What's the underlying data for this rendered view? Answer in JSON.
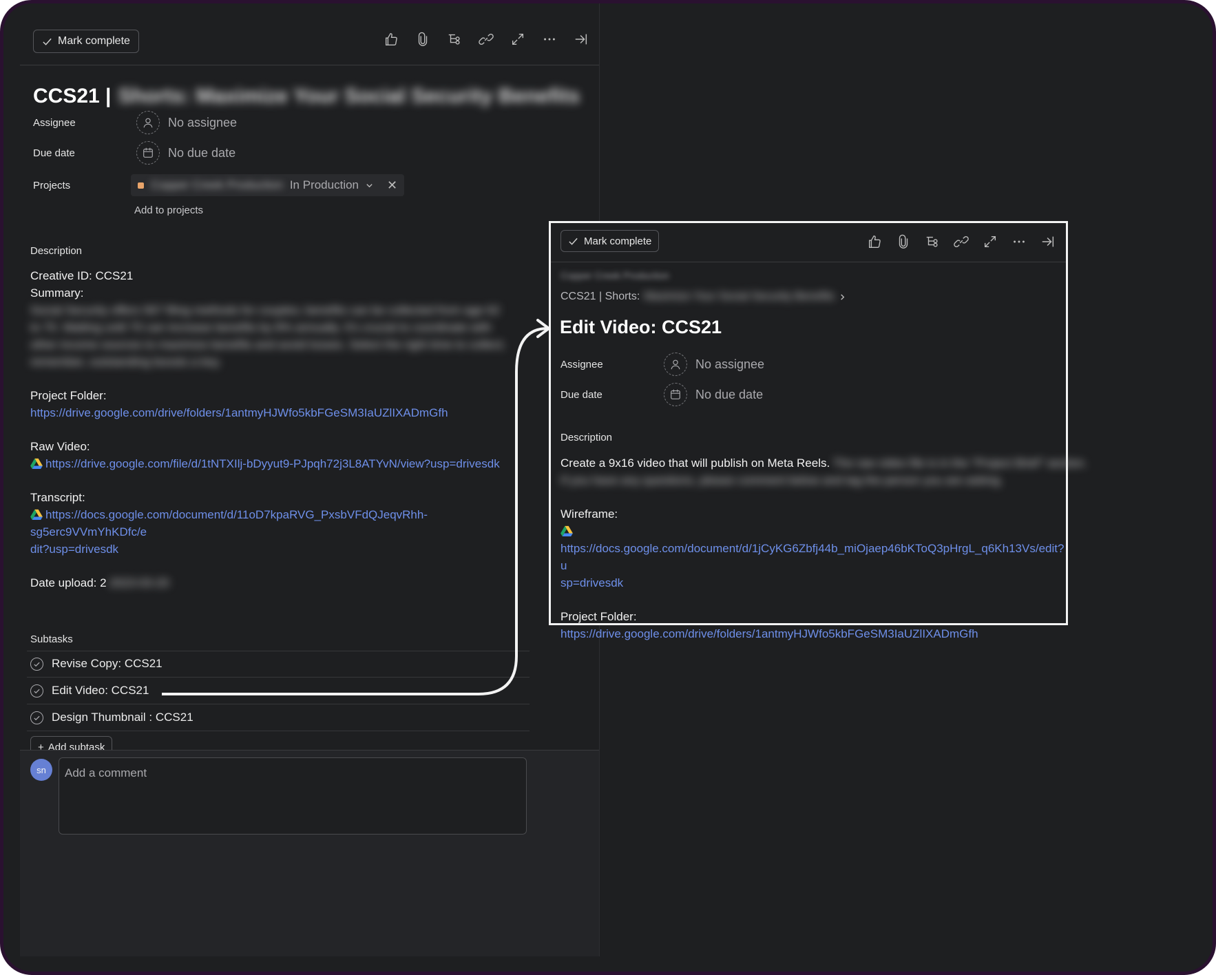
{
  "left": {
    "toolbar": {
      "mark_complete": "Mark complete"
    },
    "title_prefix": "CCS21 |",
    "title_redacted": "Shorts: Maximize Your Social Security Benefits",
    "assignee": {
      "label": "Assignee",
      "value": "No assignee"
    },
    "due_date": {
      "label": "Due date",
      "value": "No due date"
    },
    "projects": {
      "label": "Projects",
      "project_name_redacted": "Copper Creek Production",
      "section": "In Production",
      "add": "Add to projects"
    },
    "description": {
      "label": "Description",
      "creative_id": "Creative ID: CCS21",
      "summary_label": "Summary:",
      "summary_redacted": "Social Security offers 567 filing methods for couples; benefits can be collected from age 62 to 70. Waiting until 70 can increase benefits by 8% annually. It's crucial to coordinate with other income sources to maximize benefits and avoid losses. Select the right time to collect; remember, outstanding boosts a key.",
      "project_folder_label": "Project Folder:",
      "project_folder_url": "https://drive.google.com/drive/folders/1antmyHJWfo5kbFGeSM3IaUZlIXADmGfh",
      "raw_video_label": "Raw Video:",
      "raw_video_url": "https://drive.google.com/file/d/1tNTXIlj-bDyyut9-PJpqh72j3L8ATYvN/view?usp=drivesdk",
      "transcript_label": "Transcript:",
      "transcript_url_1": "https://docs.google.com/document/d/11oD7kpaRVG_PxsbVFdQJeqvRhh-sg5erc9VVmYhKDfc/e",
      "transcript_url_2": "dit?usp=drivesdk",
      "date_upload_label": "Date upload: 2",
      "date_upload_redacted": "2023-03-20"
    },
    "subtasks": {
      "label": "Subtasks",
      "items": [
        "Revise Copy: CCS21",
        "Edit Video: CCS21",
        "Design Thumbnail : CCS21"
      ],
      "add": "Add subtask"
    },
    "comment": {
      "avatar": "sn",
      "placeholder": "Add a comment"
    }
  },
  "right": {
    "toolbar": {
      "mark_complete": "Mark complete"
    },
    "crumb_redacted": "Copper Creek Production",
    "parent_prefix": "CCS21 | Shorts:",
    "parent_redacted": "Maximize Your Social Security Benefits",
    "title": "Edit Video: CCS21",
    "assignee": {
      "label": "Assignee",
      "value": "No assignee"
    },
    "due_date": {
      "label": "Due date",
      "value": "No due date"
    },
    "description": {
      "label": "Description",
      "line1": "Create a 9x16 video that will publish on Meta Reels.",
      "line1_redacted": "The raw video file is in the \"Project Brief\" section.",
      "line2_redacted": "If you have any questions, please comment below and tag the person you are asking.",
      "wireframe_label": "Wireframe:",
      "wireframe_url_1": "https://docs.google.com/document/d/1jCyKG6Zbfj44b_miOjaep46bKToQ3pHrgL_q6Kh13Vs/edit?u",
      "wireframe_url_2": "sp=drivesdk",
      "project_folder_label": "Project Folder:",
      "project_folder_url": "https://drive.google.com/drive/folders/1antmyHJWfo5kbFGeSM3IaUZlIXADmGfh"
    }
  },
  "colors": {
    "background": "#1e1f21",
    "link": "#6e8fe9",
    "project_dot": "#e8a46a",
    "avatar": "#6680d4"
  }
}
